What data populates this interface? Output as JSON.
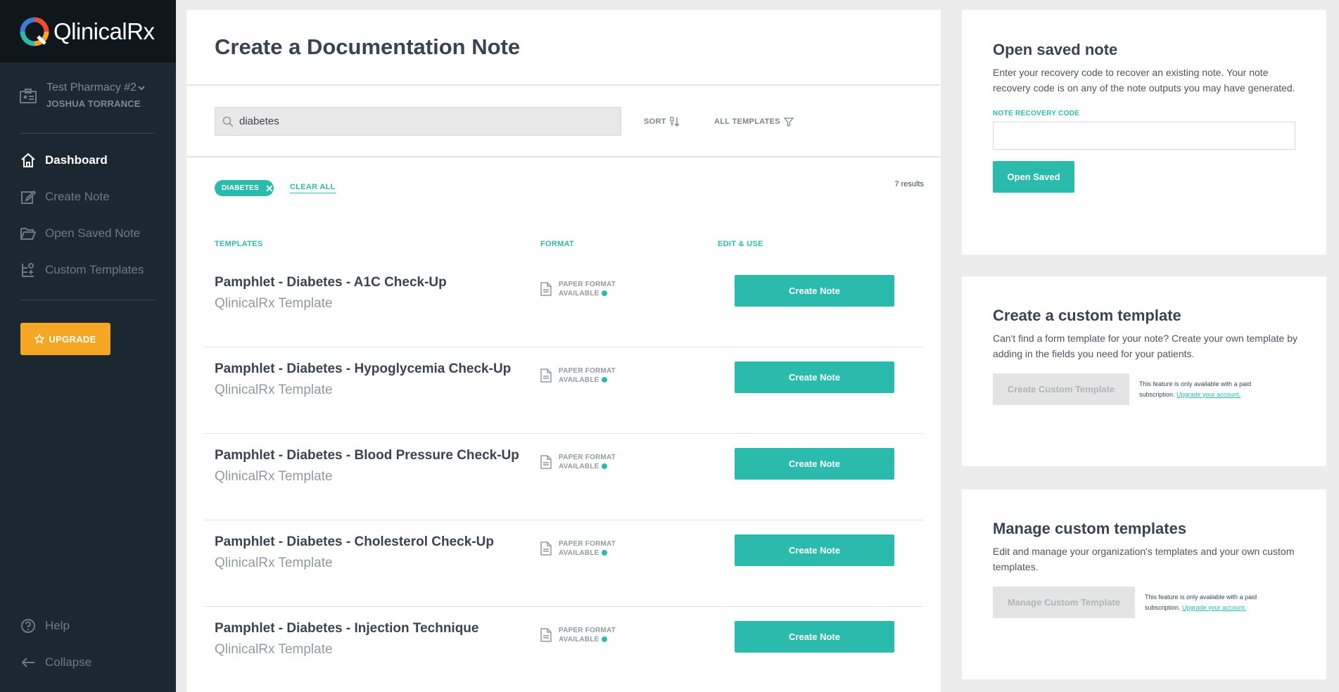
{
  "brand": {
    "name": "QlinicalRx"
  },
  "sidebar": {
    "org_name": "Test Pharmacy #2",
    "org_user": "JOSHUA TORRANCE",
    "nav": [
      {
        "label": "Dashboard",
        "icon": "home-icon",
        "active": true
      },
      {
        "label": "Create Note",
        "icon": "edit-icon"
      },
      {
        "label": "Open Saved Note",
        "icon": "folder-open-icon"
      },
      {
        "label": "Custom Templates",
        "icon": "custom-templates-icon"
      }
    ],
    "upgrade_label": "UPGRADE",
    "footer": [
      {
        "label": "Help",
        "icon": "help-icon"
      },
      {
        "label": "Collapse",
        "icon": "arrow-left-icon"
      }
    ]
  },
  "main": {
    "title": "Create a Documentation Note",
    "search": {
      "value": "diabetes"
    },
    "sort_label": "SORT",
    "filter_label": "ALL TEMPLATES",
    "chip_label": "DIABETES",
    "clear_all": "CLEAR ALL",
    "results": "7 results",
    "columns": {
      "templates": "TEMPLATES",
      "format": "FORMAT",
      "edit": "EDIT & USE"
    },
    "rows": [
      {
        "title": "Pamphlet - Diabetes - A1C Check-Up",
        "source": "QlinicalRx Template",
        "format_line1": "PAPER FORMAT",
        "format_line2": "AVAILABLE",
        "button": "Create Note"
      },
      {
        "title": "Pamphlet - Diabetes - Hypoglycemia Check-Up",
        "source": "QlinicalRx Template",
        "format_line1": "PAPER FORMAT",
        "format_line2": "AVAILABLE",
        "button": "Create Note"
      },
      {
        "title": "Pamphlet - Diabetes - Blood Pressure Check-Up",
        "source": "QlinicalRx Template",
        "format_line1": "PAPER FORMAT",
        "format_line2": "AVAILABLE",
        "button": "Create Note"
      },
      {
        "title": "Pamphlet - Diabetes - Cholesterol Check-Up",
        "source": "QlinicalRx Template",
        "format_line1": "PAPER FORMAT",
        "format_line2": "AVAILABLE",
        "button": "Create Note"
      },
      {
        "title": "Pamphlet - Diabetes - Injection Technique",
        "source": "QlinicalRx Template",
        "format_line1": "PAPER FORMAT",
        "format_line2": "AVAILABLE",
        "button": "Create Note"
      }
    ]
  },
  "open_saved": {
    "title": "Open saved note",
    "desc": "Enter your recovery code to recover an existing note. Your note recovery code is on any of the note outputs you may have generated.",
    "field_label": "NOTE RECOVERY CODE",
    "field_value": "",
    "button": "Open Saved"
  },
  "custom_template": {
    "title": "Create a custom template",
    "desc": "Can't find a form template for your note? Create your own template by adding in the fields you need for your patients.",
    "button": "Create Custom Template",
    "note": "This feature is only available with a paid subscription.",
    "link": "Upgrade your account."
  },
  "manage_templates": {
    "title": "Manage custom templates",
    "desc": "Edit and manage your organization's templates and your own custom templates.",
    "button": "Manage Custom Template",
    "note": "This feature is only available with a paid subscription.",
    "link": "Upgrade your account."
  },
  "colors": {
    "accent": "#2bbbad",
    "sidebar": "#1c2831",
    "upgrade": "#f5a623"
  }
}
